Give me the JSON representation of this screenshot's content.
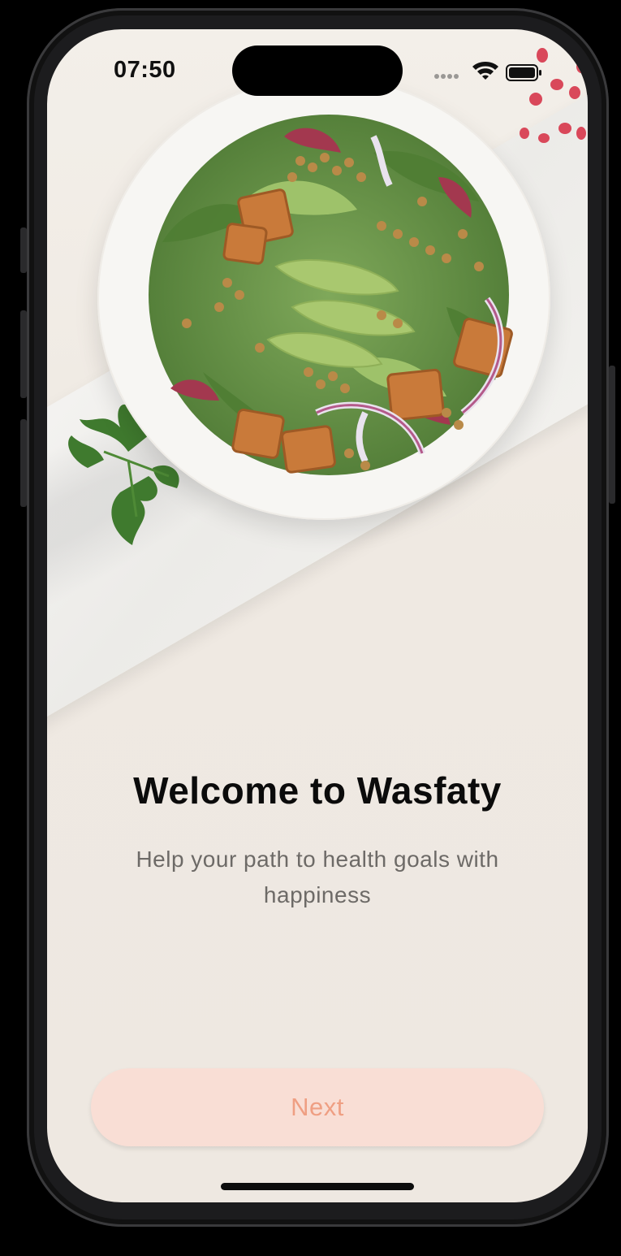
{
  "status_bar": {
    "time": "07:50",
    "icons": [
      "signal-dots-icon",
      "wifi-icon",
      "battery-icon"
    ]
  },
  "hero": {
    "image": "salad-bowl-illustration"
  },
  "content": {
    "title": "Welcome to Wasfaty",
    "subtitle": "Help your path to health goals with happiness"
  },
  "actions": {
    "next_label": "Next"
  },
  "colors": {
    "background": "#efe9e2",
    "title": "#0b0b0b",
    "subtitle": "#6d6a67",
    "button_bg": "#f9ded5",
    "button_text": "#ef9f83"
  }
}
